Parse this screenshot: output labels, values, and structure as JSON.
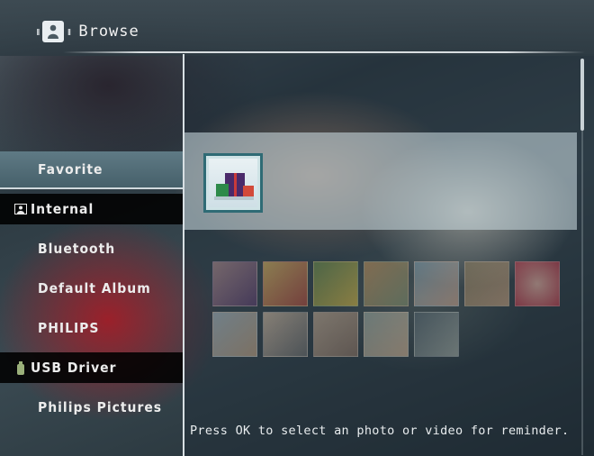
{
  "header": {
    "title": "Browse",
    "icon": "person-icon"
  },
  "sidebar": {
    "items": [
      {
        "label": "Favorite",
        "state": "selected"
      },
      {
        "label": "Internal",
        "icon": "internal-memory-icon",
        "state": "section"
      },
      {
        "label": "Bluetooth"
      },
      {
        "label": "Default Album"
      },
      {
        "label": "PHILIPS"
      },
      {
        "label": "USB Driver",
        "icon": "usb-icon",
        "state": "section"
      },
      {
        "label": "Philips Pictures"
      }
    ]
  },
  "content": {
    "selected_thumbnail": "photo-thumbnail-selected",
    "thumbnails_row1": 7,
    "thumbnails_row2": 5
  },
  "hint": "Press OK to select an photo or video for reminder.",
  "colors": {
    "accent": "#2f6b75",
    "divider": "#d7dfe3",
    "selected_bg": "#5f7a85"
  }
}
